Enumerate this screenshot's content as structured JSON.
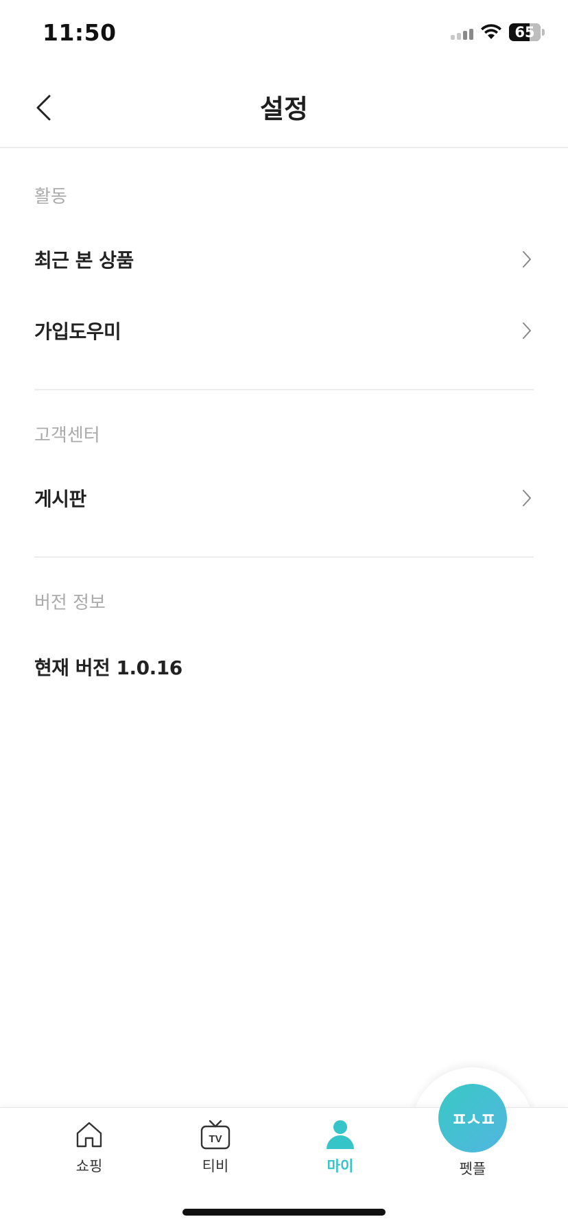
{
  "status_bar": {
    "time": "11:50",
    "battery": "65"
  },
  "header": {
    "title": "설정"
  },
  "sections": [
    {
      "label": "활동",
      "items": [
        {
          "label": "최근 본 상품"
        },
        {
          "label": "가입도우미"
        }
      ]
    },
    {
      "label": "고객센터",
      "items": [
        {
          "label": "게시판"
        }
      ]
    },
    {
      "label": "버전 정보",
      "items": [
        {
          "label": "현재 버전 1.0.16"
        }
      ]
    }
  ],
  "tabbar": {
    "tabs": [
      {
        "label": "쇼핑",
        "icon": "home-icon"
      },
      {
        "label": "티비",
        "icon": "tv-icon"
      },
      {
        "label": "마이",
        "icon": "person-icon",
        "active": true
      },
      {
        "label": "펫플",
        "icon": "petple-logo"
      }
    ],
    "active_color": "#35c4c8",
    "tv_icon_text": "TV",
    "fab_logo_text": "ㅍㅅㅍ"
  }
}
